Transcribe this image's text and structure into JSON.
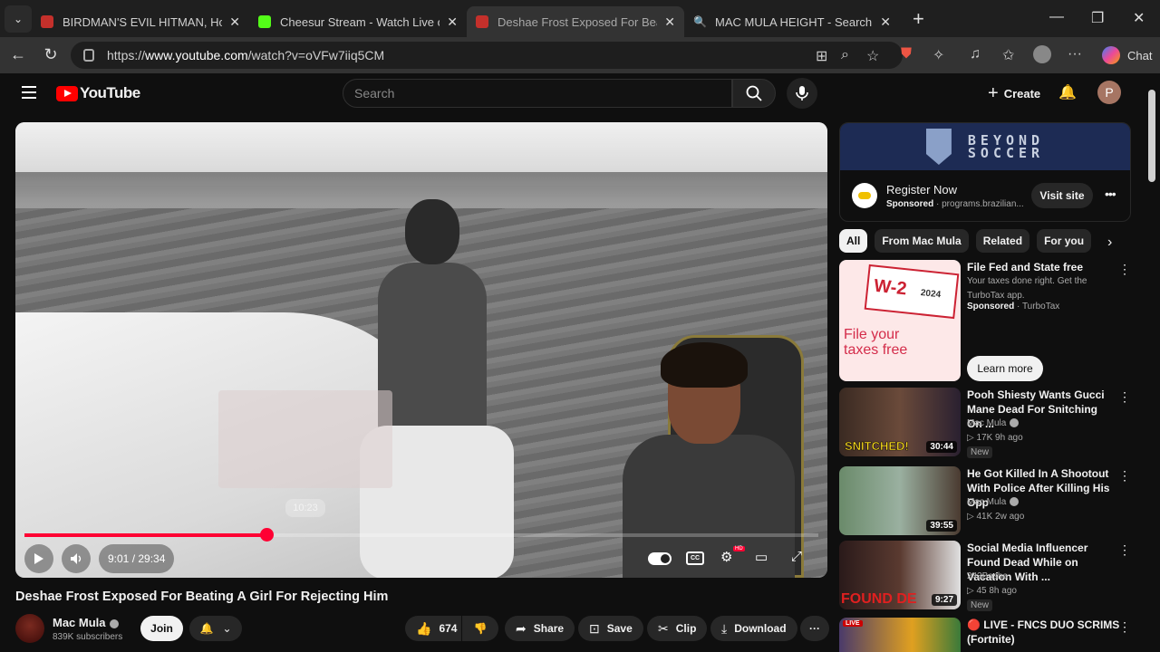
{
  "browser": {
    "tabs": [
      {
        "title": "BIRDMAN'S EVIL HITMAN, How Ha",
        "favicon_color": "#c4302b"
      },
      {
        "title": "Cheesur Stream - Watch Live on Ki",
        "favicon_color": "#53fc18"
      },
      {
        "title": "Deshae Frost Exposed For Beating",
        "favicon_color": "#c4302b"
      },
      {
        "title": "MAC MULA HEIGHT - Search",
        "favicon_color": "#2b6fd6"
      }
    ],
    "url_prefix": "https://",
    "url_host": "www.youtube.com",
    "url_path": "/watch?v=oVFw7iiq5CM",
    "chat_label": "Chat"
  },
  "youtube": {
    "logo_text": "YouTube",
    "search_placeholder": "Search",
    "create_label": "Create",
    "avatar_letter": "P"
  },
  "player": {
    "time_current": "9:01",
    "time_total": "29:34",
    "time_display": "9:01 / 29:34",
    "progress_fraction": 0.305,
    "hover_time": "10:23"
  },
  "video": {
    "title": "Deshae Frost Exposed For Beating A Girl For Rejecting Him",
    "channel": "Mac Mula",
    "subscribers": "839K subscribers",
    "join_label": "Join",
    "likes": "674",
    "share_label": "Share",
    "save_label": "Save",
    "clip_label": "Clip",
    "download_label": "Download"
  },
  "ad": {
    "banner_brand_line1": "BEYOND",
    "banner_brand_line2": "SOCCER",
    "title": "Register Now",
    "sponsored": "Sponsored",
    "domain": "· programs.brazilian...",
    "visit_label": "Visit site"
  },
  "chips": [
    "All",
    "From Mac Mula",
    "Related",
    "For you"
  ],
  "recommendations": [
    {
      "title": "File Fed and State free",
      "desc": "Your taxes done right. Get the TurboTax app.",
      "sponsored": "Sponsored",
      "advertiser": "· TurboTax",
      "thumb_heading": "File your taxes free",
      "thumb_badge": "W-2",
      "thumb_year": "2024",
      "cta": "Learn more"
    },
    {
      "title": "Pooh Shiesty Wants Gucci Mane Dead For Snitching On ...",
      "channel": "Mac Mula",
      "stats": "▷ 17K  9h ago",
      "badge": "New",
      "duration": "30:44",
      "thumb_text": "SNITCHED!"
    },
    {
      "title": "He Got Killed In A Shootout With Police After Killing His Opp",
      "channel": "Mac Mula",
      "stats": "▷ 41K  2w ago",
      "duration": "39:55"
    },
    {
      "title": "Social Media Influencer Found Dead While on Vacation With ...",
      "channel": "243Basha",
      "stats": "▷ 45  8h ago",
      "badge": "New",
      "duration": "9:27",
      "thumb_text": "FOUND DE"
    },
    {
      "title": "🔴 LIVE - FNCS DUO SCRIMS (Fortnite)",
      "thumb_badge": "LIVE"
    }
  ]
}
